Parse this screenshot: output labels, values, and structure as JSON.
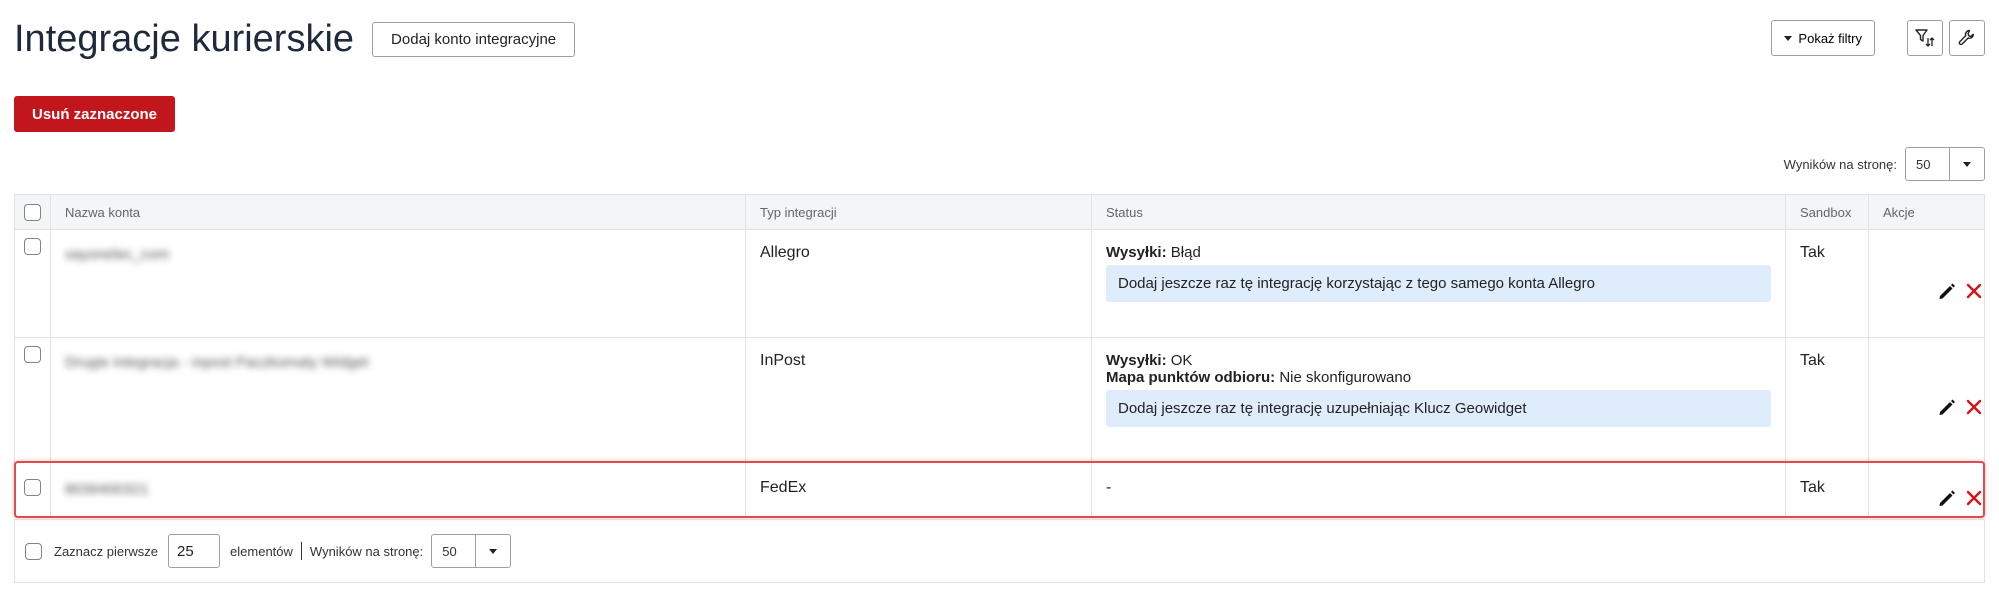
{
  "header": {
    "title": "Integracje kurierskie",
    "add_button": "Dodaj konto integracyjne"
  },
  "toolbar": {
    "show_filters": "Pokaż filtry",
    "filter_sort_icon": "filter-sort-icon",
    "settings_icon": "wrench-icon"
  },
  "delete_selected": "Usuń zaznaczone",
  "per_page_top": {
    "label": "Wyników na stronę:",
    "value": "50"
  },
  "table": {
    "columns": [
      "Nazwa konta",
      "Typ integracji",
      "Status",
      "Sandbox",
      "Akcje"
    ],
    "rows": [
      {
        "name": "sayonelec_com",
        "type": "Allegro",
        "status_lines": [
          {
            "label": "Wysyłki:",
            "value": "Błąd"
          }
        ],
        "note": "Dodaj jeszcze raz tę integrację korzystając z tego samego konta Allegro",
        "sandbox": "Tak"
      },
      {
        "name": "Drugie integracja - inpost Paczkomaty Widget",
        "type": "InPost",
        "status_lines": [
          {
            "label": "Wysyłki:",
            "value": "OK"
          },
          {
            "label": "Mapa punktów odbioru:",
            "value": "Nie skonfigurowano"
          }
        ],
        "note": "Dodaj jeszcze raz tę integrację uzupełniając Klucz Geowidget",
        "sandbox": "Tak"
      },
      {
        "name": "8039400321",
        "type": "FedEx",
        "status_text": "-",
        "sandbox": "Tak"
      }
    ]
  },
  "footer": {
    "select_first_label": "Zaznacz pierwsze",
    "select_first_value": "25",
    "elements_label": "elementów",
    "per_page_label": "Wyników na stronę:",
    "per_page_value": "50"
  },
  "colors": {
    "danger": "#c0161c",
    "note_bg": "#dfecfb",
    "highlight": "#e04b4b",
    "delete_icon": "#d4141b"
  }
}
